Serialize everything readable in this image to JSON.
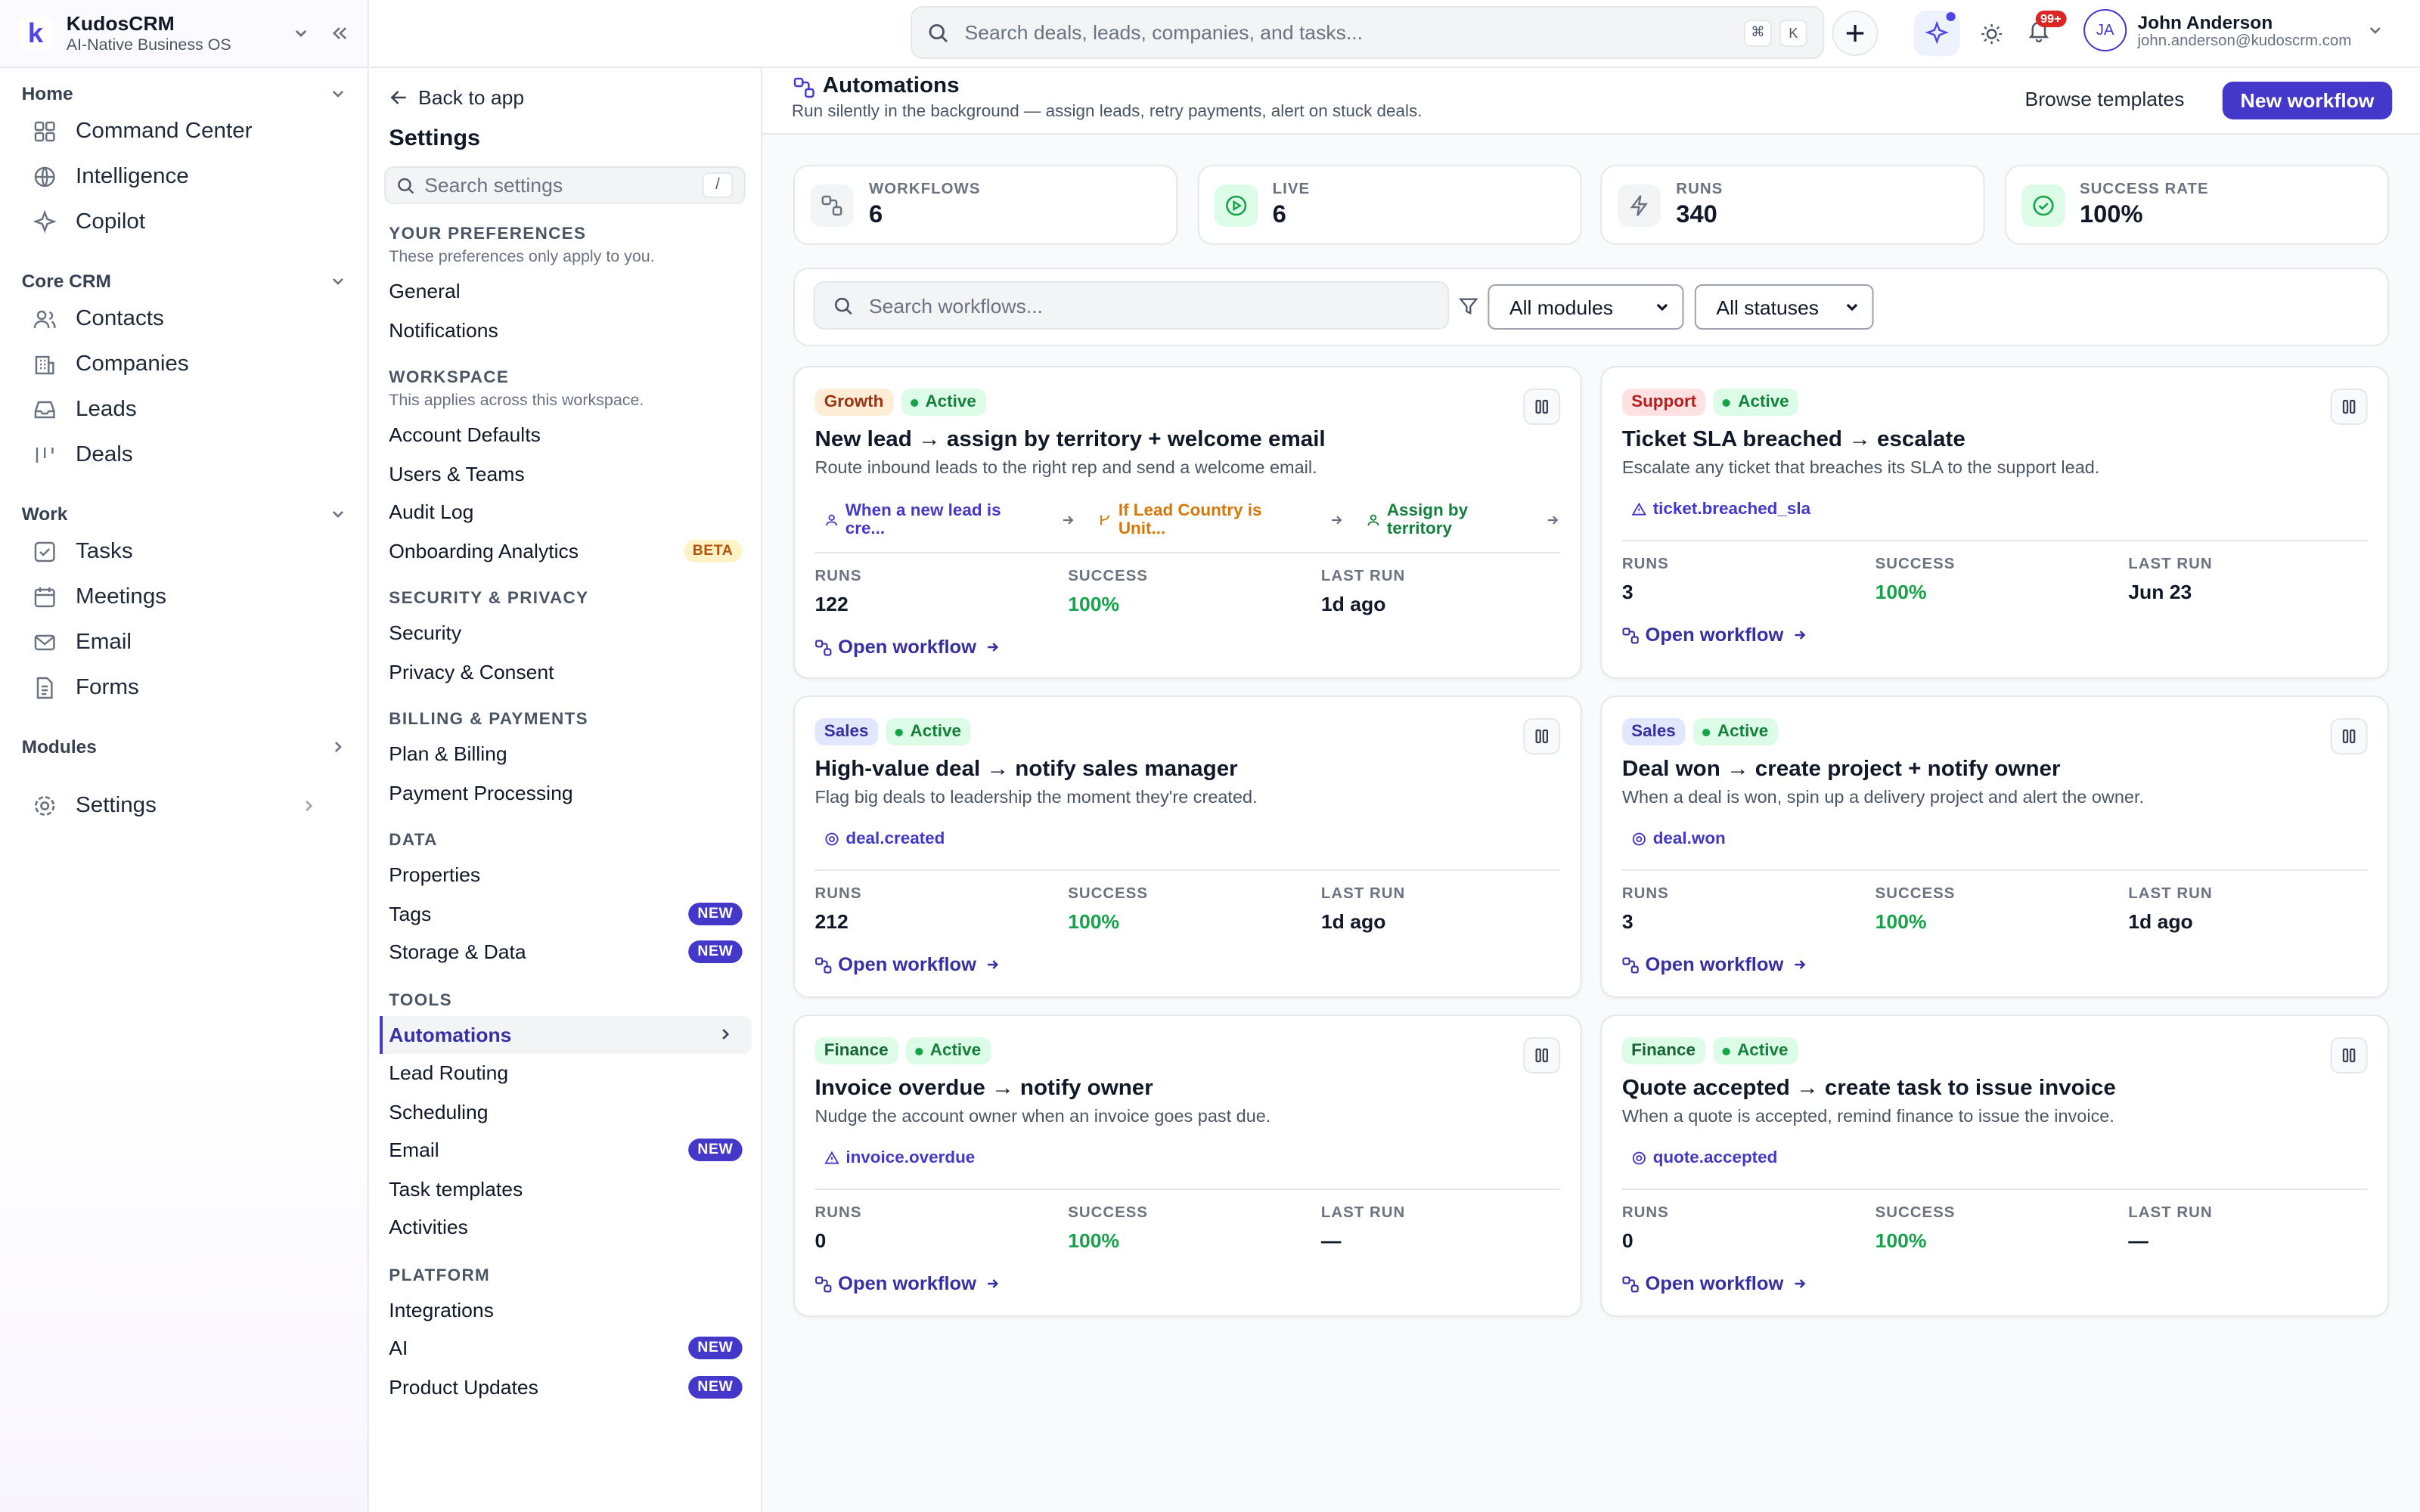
{
  "brand": {
    "name": "KudosCRM",
    "tagline": "AI-Native Business OS",
    "logo": "k"
  },
  "sidebar": {
    "home_label": "Home",
    "core_label": "Core CRM",
    "work_label": "Work",
    "modules_label": "Modules",
    "home": [
      {
        "label": "Command Center",
        "icon": "grid-icon"
      },
      {
        "label": "Intelligence",
        "icon": "globe-icon"
      },
      {
        "label": "Copilot",
        "icon": "sparkle-icon"
      }
    ],
    "core": [
      {
        "label": "Contacts",
        "icon": "users-icon"
      },
      {
        "label": "Companies",
        "icon": "building-icon"
      },
      {
        "label": "Leads",
        "icon": "inbox-icon"
      },
      {
        "label": "Deals",
        "icon": "pipeline-icon"
      }
    ],
    "work": [
      {
        "label": "Tasks",
        "icon": "checkbox-icon"
      },
      {
        "label": "Meetings",
        "icon": "calendar-icon"
      },
      {
        "label": "Email",
        "icon": "mail-icon"
      },
      {
        "label": "Forms",
        "icon": "document-icon"
      }
    ],
    "settings_label": "Settings"
  },
  "search": {
    "placeholder": "Search deals, leads, companies, and tasks...",
    "k1": "⌘",
    "k2": "K"
  },
  "topbar": {
    "notif_count": "99+",
    "user_initials": "JA",
    "user_name": "John Anderson",
    "user_email": "john.anderson@kudoscrm.com"
  },
  "settings": {
    "back": "Back to app",
    "title": "Settings",
    "search_placeholder": "Search settings",
    "search_key": "/",
    "pref_title": "YOUR PREFERENCES",
    "pref_sub": "These preferences only apply to you.",
    "pref_items": [
      "General",
      "Notifications"
    ],
    "ws_title": "WORKSPACE",
    "ws_sub": "This applies across this workspace.",
    "ws_items": [
      "Account Defaults",
      "Users & Teams",
      "Audit Log",
      "Onboarding Analytics"
    ],
    "beta": "BETA",
    "sec_title": "SECURITY & PRIVACY",
    "sec_items": [
      "Security",
      "Privacy & Consent"
    ],
    "bill_title": "BILLING & PAYMENTS",
    "bill_items": [
      "Plan & Billing",
      "Payment Processing"
    ],
    "data_title": "DATA",
    "data_items": [
      "Properties",
      "Tags",
      "Storage & Data"
    ],
    "tools_title": "TOOLS",
    "tools_items": [
      "Automations",
      "Lead Routing",
      "Scheduling",
      "Email",
      "Task templates",
      "Activities"
    ],
    "plat_title": "PLATFORM",
    "plat_items": [
      "Integrations",
      "AI",
      "Product Updates"
    ],
    "new": "NEW"
  },
  "page": {
    "title": "Automations",
    "subtitle": "Run silently in the background — assign leads, retry payments, alert on stuck deals.",
    "browse": "Browse templates",
    "new_workflow": "New workflow"
  },
  "stats": [
    {
      "label": "WORKFLOWS",
      "value": "6"
    },
    {
      "label": "LIVE",
      "value": "6"
    },
    {
      "label": "RUNS",
      "value": "340"
    },
    {
      "label": "SUCCESS RATE",
      "value": "100%"
    }
  ],
  "filters": {
    "search_placeholder": "Search workflows...",
    "modules": "All modules",
    "statuses": "All statuses"
  },
  "metrics": {
    "runs": "RUNS",
    "success": "SUCCESS",
    "last_run": "LAST RUN",
    "open": "Open workflow"
  },
  "workflows": [
    {
      "tag": "Growth",
      "status": "Active",
      "title": "New lead → assign by territory + welcome email",
      "desc": "Route inbound leads to the right rep and send a welcome email.",
      "steps": [
        "When a new lead is cre...",
        "If Lead Country is Unit...",
        "Assign by territory"
      ],
      "runs": "122",
      "success": "100%",
      "last": "1d ago"
    },
    {
      "tag": "Support",
      "status": "Active",
      "title": "Ticket SLA breached → escalate",
      "desc": "Escalate any ticket that breaches its SLA to the support lead.",
      "trigger": "ticket.breached_sla",
      "runs": "3",
      "success": "100%",
      "last": "Jun 23"
    },
    {
      "tag": "Sales",
      "status": "Active",
      "title": "High-value deal → notify sales manager",
      "desc": "Flag big deals to leadership the moment they're created.",
      "trigger": "deal.created",
      "runs": "212",
      "success": "100%",
      "last": "1d ago"
    },
    {
      "tag": "Sales",
      "status": "Active",
      "title": "Deal won → create project + notify owner",
      "desc": "When a deal is won, spin up a delivery project and alert the owner.",
      "trigger": "deal.won",
      "runs": "3",
      "success": "100%",
      "last": "1d ago"
    },
    {
      "tag": "Finance",
      "status": "Active",
      "title": "Invoice overdue → notify owner",
      "desc": "Nudge the account owner when an invoice goes past due.",
      "trigger": "invoice.overdue",
      "runs": "0",
      "success": "100%",
      "last": "—"
    },
    {
      "tag": "Finance",
      "status": "Active",
      "title": "Quote accepted → create task to issue invoice",
      "desc": "When a quote is accepted, remind finance to issue the invoice.",
      "trigger": "quote.accepted",
      "runs": "0",
      "success": "100%",
      "last": "—"
    }
  ],
  "colors": {
    "accent": "#4338ca",
    "success": "#16a34a",
    "growth_bg": "#ffedd5",
    "growth_fg": "#9a3412",
    "support_bg": "#fee2e2",
    "support_fg": "#b91c1c",
    "sales_bg": "#e0e7ff",
    "sales_fg": "#3730a3",
    "finance_bg": "#dcfce7",
    "finance_fg": "#166534"
  }
}
